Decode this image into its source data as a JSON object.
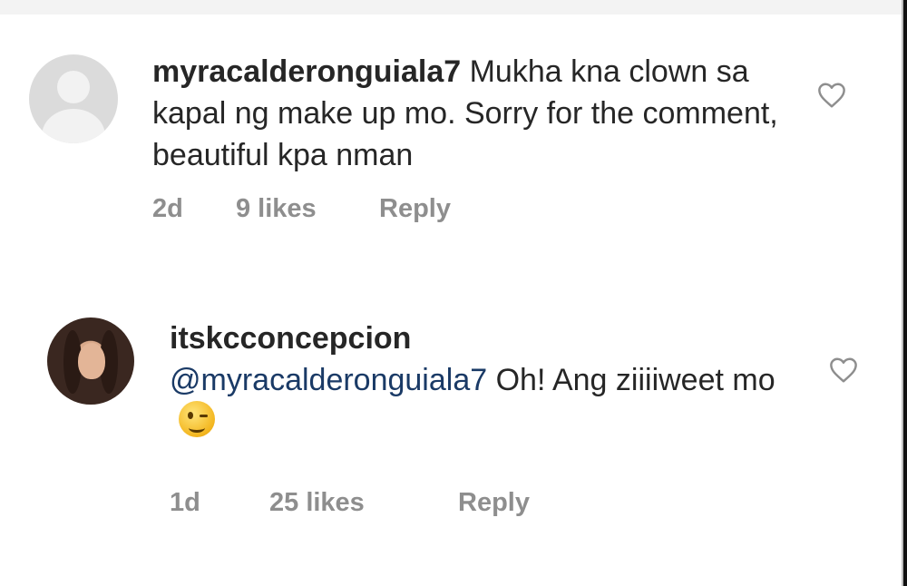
{
  "comments": [
    {
      "username": "myracalderonguiala7",
      "text": " Mukha kna clown sa kapal ng make up mo. Sorry for the comment, beautiful kpa nman",
      "time": "2d",
      "likes": "9 likes",
      "reply_label": "Reply",
      "avatar_icon": "default-avatar-icon",
      "like_icon": "heart-outline-icon"
    },
    {
      "username": "itskcconcepcion",
      "mention": "@myracalderonguiala7",
      "text": " Oh! Ang ziiiiweet mo",
      "emoji_icon": "winking-face-emoji-icon",
      "time": "1d",
      "likes": "25 likes",
      "reply_label": "Reply",
      "avatar_icon": "profile-photo-avatar",
      "like_icon": "heart-outline-icon"
    }
  ],
  "colors": {
    "text": "#262626",
    "meta": "#8e8e8e",
    "mention": "#1a3a66",
    "background": "#ffffff"
  }
}
